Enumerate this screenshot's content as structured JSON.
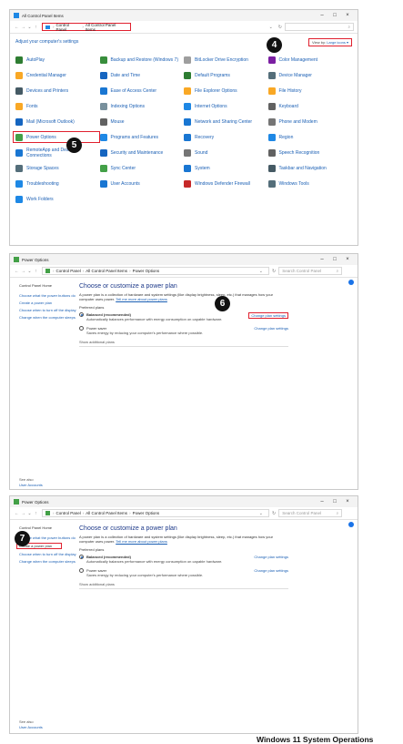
{
  "colors": {
    "link": "#1a5fb4",
    "highlight": "#e0202e",
    "badge": "#111111"
  },
  "w1": {
    "title": "All Control Panel Items",
    "controls": [
      "–",
      "□",
      "×"
    ],
    "crumbs": [
      "Control Panel",
      "All Control Panel Items"
    ],
    "adjust": "Adjust your computer's settings",
    "view_by": "View by:",
    "view_by_value": "Large icons ▾",
    "badge4": "4",
    "badge5": "5",
    "items": [
      {
        "label": "AutoPlay",
        "icon": "autoplay-icon",
        "color": "#2e7d32"
      },
      {
        "label": "Backup and Restore (Windows 7)",
        "icon": "backup-icon",
        "color": "#388e3c"
      },
      {
        "label": "BitLocker Drive Encryption",
        "icon": "bitlocker-icon",
        "color": "#9e9e9e"
      },
      {
        "label": "Color Management",
        "icon": "color-management-icon",
        "color": "#7b1fa2"
      },
      {
        "label": "Credential Manager",
        "icon": "credential-manager-icon",
        "color": "#f9a825"
      },
      {
        "label": "Date and Time",
        "icon": "date-time-icon",
        "color": "#1565c0"
      },
      {
        "label": "Default Programs",
        "icon": "default-programs-icon",
        "color": "#2e7d32"
      },
      {
        "label": "Device Manager",
        "icon": "device-manager-icon",
        "color": "#546e7a"
      },
      {
        "label": "Devices and Printers",
        "icon": "devices-printers-icon",
        "color": "#455a64"
      },
      {
        "label": "Ease of Access Center",
        "icon": "ease-of-access-icon",
        "color": "#1976d2"
      },
      {
        "label": "File Explorer Options",
        "icon": "file-explorer-options-icon",
        "color": "#f9a825"
      },
      {
        "label": "File History",
        "icon": "file-history-icon",
        "color": "#f9a825"
      },
      {
        "label": "Fonts",
        "icon": "fonts-icon",
        "color": "#f9a825"
      },
      {
        "label": "Indexing Options",
        "icon": "indexing-options-icon",
        "color": "#78909c"
      },
      {
        "label": "Internet Options",
        "icon": "internet-options-icon",
        "color": "#1e88e5"
      },
      {
        "label": "Keyboard",
        "icon": "keyboard-icon",
        "color": "#616161"
      },
      {
        "label": "Mail (Microsoft Outlook)",
        "icon": "mail-icon",
        "color": "#1565c0"
      },
      {
        "label": "Mouse",
        "icon": "mouse-icon",
        "color": "#616161"
      },
      {
        "label": "Network and Sharing Center",
        "icon": "network-icon",
        "color": "#1976d2"
      },
      {
        "label": "Phone and Modem",
        "icon": "phone-modem-icon",
        "color": "#757575"
      },
      {
        "label": "Power Options",
        "icon": "power-options-icon",
        "color": "#43a047"
      },
      {
        "label": "Programs and Features",
        "icon": "programs-features-icon",
        "color": "#1e88e5"
      },
      {
        "label": "Recovery",
        "icon": "recovery-icon",
        "color": "#1976d2"
      },
      {
        "label": "Region",
        "icon": "region-icon",
        "color": "#1e88e5"
      },
      {
        "label": "RemoteApp and Desktop Connections",
        "icon": "remoteapp-icon",
        "color": "#1976d2"
      },
      {
        "label": "Security and Maintenance",
        "icon": "security-maintenance-icon",
        "color": "#1565c0"
      },
      {
        "label": "Sound",
        "icon": "sound-icon",
        "color": "#757575"
      },
      {
        "label": "Speech Recognition",
        "icon": "speech-recognition-icon",
        "color": "#616161"
      },
      {
        "label": "Storage Spaces",
        "icon": "storage-spaces-icon",
        "color": "#546e7a"
      },
      {
        "label": "Sync Center",
        "icon": "sync-center-icon",
        "color": "#43a047"
      },
      {
        "label": "System",
        "icon": "system-icon",
        "color": "#1976d2"
      },
      {
        "label": "Taskbar and Navigation",
        "icon": "taskbar-icon",
        "color": "#455a64"
      },
      {
        "label": "Troubleshooting",
        "icon": "troubleshooting-icon",
        "color": "#1e88e5"
      },
      {
        "label": "User Accounts",
        "icon": "user-accounts-icon",
        "color": "#1976d2"
      },
      {
        "label": "Windows Defender Firewall",
        "icon": "firewall-icon",
        "color": "#c62828"
      },
      {
        "label": "Windows Tools",
        "icon": "windows-tools-icon",
        "color": "#546e7a"
      },
      {
        "label": "Work Folders",
        "icon": "work-folders-icon",
        "color": "#1e88e5"
      }
    ]
  },
  "power": {
    "title": "Power Options",
    "crumbs": [
      "Control Panel",
      "All Control Panel Items",
      "Power Options"
    ],
    "search_placeholder": "Search Control Panel",
    "side_home": "Control Panel Home",
    "side_links": [
      "Choose what the power buttons do",
      "Create a power plan",
      "Choose when to turn off the display",
      "Change when the computer sleeps"
    ],
    "see_also": "See also",
    "user_accounts": "User Accounts",
    "heading": "Choose or customize a power plan",
    "intro": "A power plan is a collection of hardware and system settings (like display brightness, sleep, etc.) that manages how your computer uses power.",
    "intro_link": "Tell me more about power plans",
    "preferred": "Preferred plans",
    "plans": [
      {
        "name": "Balanced (recommended)",
        "desc": "Automatically balances performance with energy consumption on capable hardware.",
        "link": "Change plan settings"
      },
      {
        "name": "Power saver",
        "desc": "Saves energy by reducing your computer's performance where possible.",
        "link": "Change plan settings"
      }
    ],
    "show_additional": "Show additional plans",
    "badge6": "6",
    "badge7": "7"
  },
  "footer": "Windows 11 System Operations"
}
